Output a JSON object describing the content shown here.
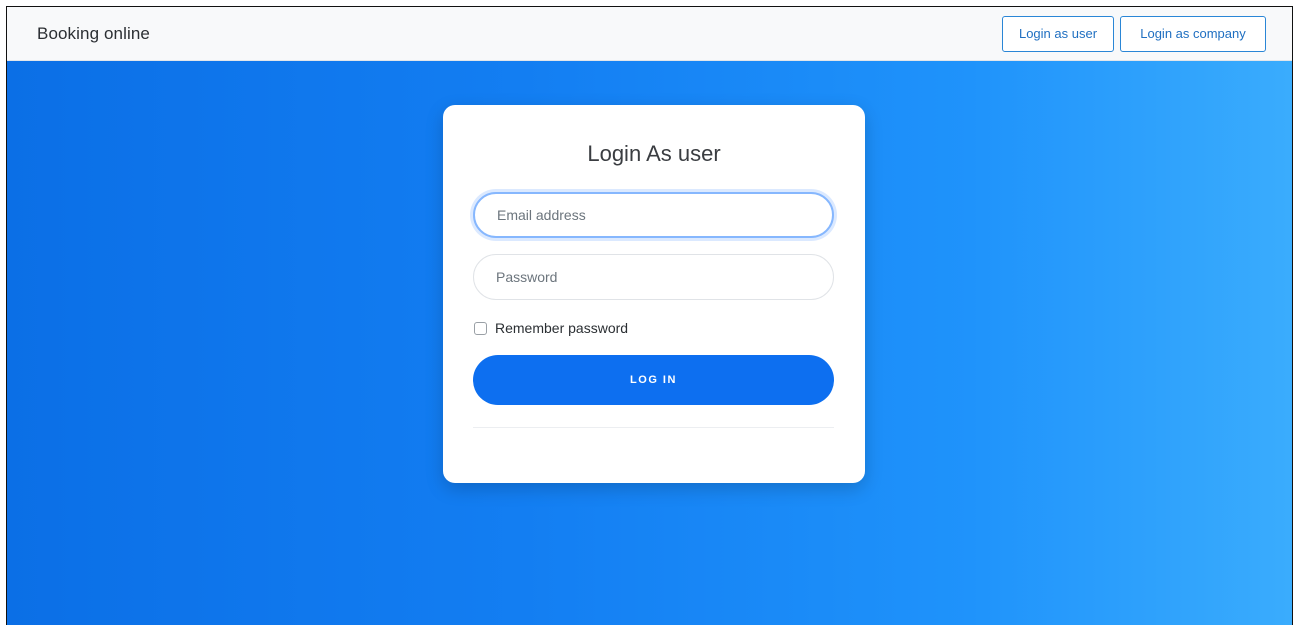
{
  "navbar": {
    "brand": "Booking online",
    "login_user_label": "Login as user",
    "login_company_label": "Login as company"
  },
  "login_card": {
    "title": "Login As user",
    "email_placeholder": "Email address",
    "password_placeholder": "Password",
    "remember_label": "Remember password",
    "remember_checked": false,
    "submit_label": "LOG IN"
  },
  "colors": {
    "accent": "#0d6ff0",
    "nav_button_border": "#2a86d6",
    "gradient_start": "#0b6fe6",
    "gradient_end": "#3aacfd"
  }
}
